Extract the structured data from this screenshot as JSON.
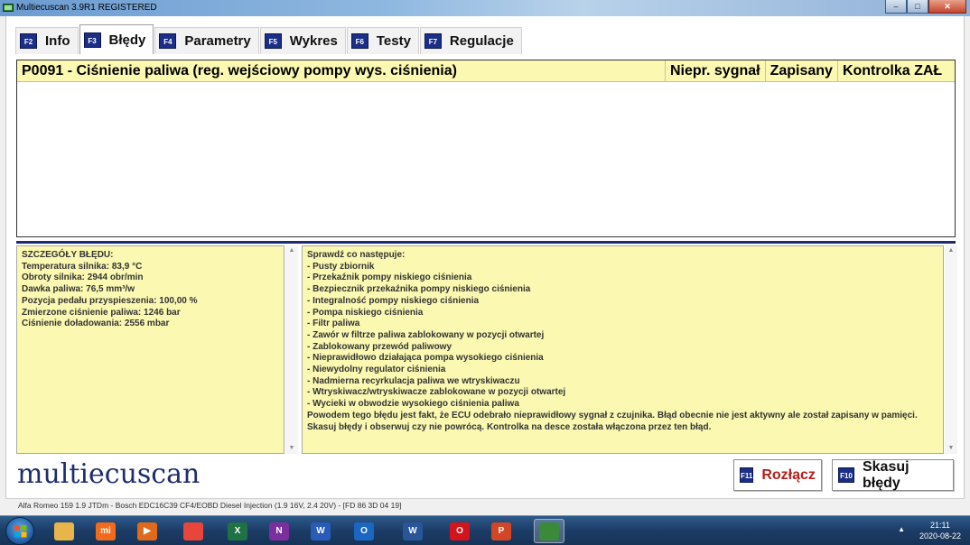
{
  "window": {
    "title": "Multiecuscan 3.9R1 REGISTERED",
    "controls": [
      "–",
      "□",
      "✕"
    ]
  },
  "tabs": [
    {
      "key": "F2",
      "label": "Info",
      "active": false
    },
    {
      "key": "F3",
      "label": "Błędy",
      "active": true
    },
    {
      "key": "F4",
      "label": "Parametry",
      "active": false
    },
    {
      "key": "F5",
      "label": "Wykres",
      "active": false
    },
    {
      "key": "F6",
      "label": "Testy",
      "active": false
    },
    {
      "key": "F7",
      "label": "Regulacje",
      "active": false
    }
  ],
  "error_table": {
    "code_desc": "P0091 - Ciśnienie paliwa (reg. wejściowy pompy wys. ciśnienia)",
    "col_signal": "Niepr. sygnał",
    "col_stored": "Zapisany",
    "col_lamp": "Kontrolka ZAŁ"
  },
  "details": {
    "heading": "SZCZEGÓŁY BŁĘDU:",
    "lines": [
      "Temperatura silnika: 83,9 °C",
      "Obroty silnika: 2944 obr/min",
      "Dawka paliwa: 76,5 mm³/w",
      "Pozycja pedału przyspieszenia: 100,00 %",
      "Zmierzone ciśnienie paliwa: 1246 bar",
      "Ciśnienie doładowania: 2556 mbar"
    ]
  },
  "checks": {
    "heading": "Sprawdź co następuje:",
    "items": [
      "- Pusty zbiornik",
      "- Przekaźnik pompy niskiego ciśnienia",
      "- Bezpiecznik przekaźnika pompy niskiego ciśnienia",
      "- Integralność pompy niskiego ciśnienia",
      "- Pompa niskiego ciśnienia",
      "- Filtr paliwa",
      "- Zawór w filtrze paliwa zablokowany w pozycji otwartej",
      "- Zablokowany przewód paliwowy",
      "- Nieprawidłowo działająca pompa wysokiego ciśnienia",
      "- Niewydolny regulator ciśnienia",
      "- Nadmierna recyrkulacja paliwa we wtryskiwaczu",
      "- Wtryskiwacz/wtryskiwacze zablokowane w pozycji otwartej",
      "- Wycieki w obwodzie wysokiego ciśnienia paliwa"
    ],
    "explanation": "Powodem tego błędu jest fakt, że ECU odebrało nieprawidłowy sygnał z czujnika. Błąd obecnie nie jest aktywny ale został zapisany w pamięci. Skasuj błędy i obserwuj czy nie powrócą. Kontrolka na desce została włączona przez ten błąd."
  },
  "logo": "multiecuscan",
  "buttons": {
    "disconnect": {
      "key": "F11",
      "label": "Rozłącz"
    },
    "clear": {
      "key": "F10",
      "label": "Skasuj błędy"
    }
  },
  "status_bar": "Alfa Romeo 159 1.9 JTDm - Bosch EDC16C39 CF4/EOBD Diesel Injection (1.9 16V, 2.4 20V) - [FD 86 3D 04 19]",
  "taskbar": {
    "time": "21:11",
    "date": "2020-08-22",
    "tray_arrow": "▲",
    "apps": [
      {
        "name": "explorer-icon",
        "glyph": "",
        "color": "#e8b54a"
      },
      {
        "name": "mi-icon",
        "glyph": "mi",
        "color": "#f26b1d"
      },
      {
        "name": "media-icon",
        "glyph": "▶",
        "color": "#e06a1b"
      },
      {
        "name": "chrome-icon",
        "glyph": "",
        "color": "#e8453c"
      },
      {
        "name": "excel-icon",
        "glyph": "X",
        "color": "#1f7244"
      },
      {
        "name": "onenote-icon",
        "glyph": "N",
        "color": "#7b2f9e"
      },
      {
        "name": "word-blue-icon",
        "glyph": "W",
        "color": "#2b5bb8"
      },
      {
        "name": "outlook-icon",
        "glyph": "O",
        "color": "#1a66c2"
      },
      {
        "name": "word-icon",
        "glyph": "W",
        "color": "#2a5699"
      },
      {
        "name": "opera-icon",
        "glyph": "O",
        "color": "#d3141c"
      },
      {
        "name": "powerpoint-icon",
        "glyph": "P",
        "color": "#d24625"
      },
      {
        "name": "multiecuscan-icon",
        "glyph": "",
        "color": "#3a8a3a"
      }
    ]
  }
}
